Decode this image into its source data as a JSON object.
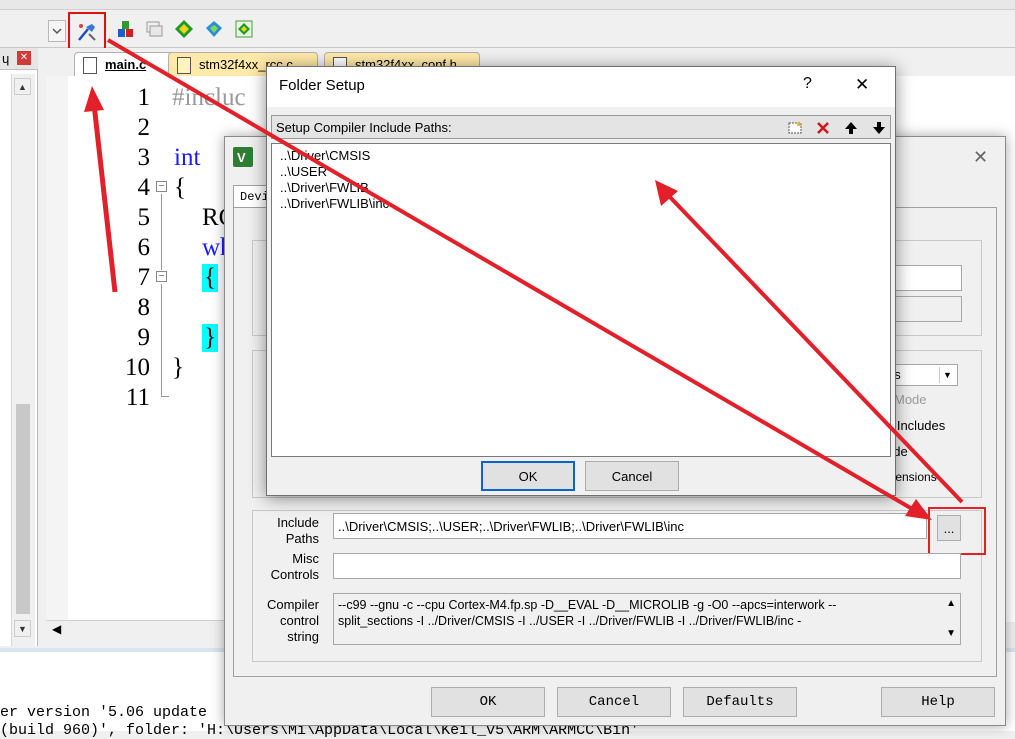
{
  "toolbar": {
    "icons": [
      "options-for-target-icon",
      "manage-components-icon",
      "batch-setup-icon",
      "pack-installer-icon",
      "debug-icon",
      "project-icon"
    ]
  },
  "tabs": [
    {
      "label": "main.c"
    },
    {
      "label": "stm32f4xx_rcc.c"
    },
    {
      "label": "stm32f4xx_conf.h"
    }
  ],
  "editor": {
    "line_numbers": [
      "1",
      "2",
      "3",
      "4",
      "5",
      "6",
      "7",
      "8",
      "9",
      "10",
      "11"
    ],
    "code": {
      "l1": "#incluc",
      "l3": "int",
      "l4": "{",
      "l5": "RC",
      "l6": "wh",
      "l7": "{",
      "l9": "}",
      "l10": "}"
    }
  },
  "output": {
    "line1": "er version '5.06 update",
    "line2": " (build 960)', folder: 'H:\\Users\\Mi\\AppData\\Local\\Keil_v5\\ARM\\ARMCC\\Bin'"
  },
  "options_dialog": {
    "tab_fragment": "Devi",
    "partial_texts": {
      "dropdown": "gs",
      "mode": "Mode",
      "includes": "o Includes",
      "ode": "ode",
      "extensions": "xtensions"
    },
    "include_paths_label": "Include Paths",
    "include_paths_value": "..\\Driver\\CMSIS;..\\USER;..\\Driver\\FWLIB;..\\Driver\\FWLIB\\inc",
    "browse_label": "...",
    "misc_controls_label": "Misc Controls",
    "misc_controls_value": "",
    "compiler_string_label": "Compiler control string",
    "compiler_string_line1": "--c99 --gnu -c --cpu Cortex-M4.fp.sp -D__EVAL -D__MICROLIB -g -O0 --apcs=interwork --",
    "compiler_string_line2": "split_sections -I ../Driver/CMSIS -I ../USER -I ../Driver/FWLIB -I ../Driver/FWLIB/inc -",
    "buttons": {
      "ok": "OK",
      "cancel": "Cancel",
      "defaults": "Defaults",
      "help": "Help"
    }
  },
  "folder_dialog": {
    "title": "Folder Setup",
    "help_glyph": "?",
    "close_glyph": "✕",
    "list_header": "Setup Compiler Include Paths:",
    "paths": [
      "..\\Driver\\CMSIS",
      "..\\USER",
      "..\\Driver\\FWLIB",
      "..\\Driver\\FWLIB\\inc"
    ],
    "ok_label": "OK",
    "cancel_label": "Cancel"
  },
  "colors": {
    "annotation_red": "#e3202a",
    "keyword_blue": "#1a1aff",
    "brace_highlight": "#00ffff"
  }
}
